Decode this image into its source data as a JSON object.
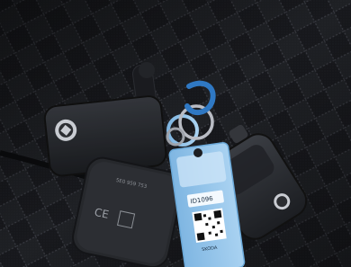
{
  "photo": {
    "subject": "car-keys-on-quilted-seat",
    "tag": {
      "code": "ID1096",
      "qr_caption": "SKODA"
    },
    "fob_back": {
      "model": "5E0 959 753",
      "marks": "CE"
    },
    "colors": {
      "seat": "#16171b",
      "stitch": "#3a3c43",
      "key_plastic": "#26282c",
      "tag_blue": "#8fc3ea",
      "ring": "#b9bcc4",
      "strap": "#2f78c3"
    }
  }
}
